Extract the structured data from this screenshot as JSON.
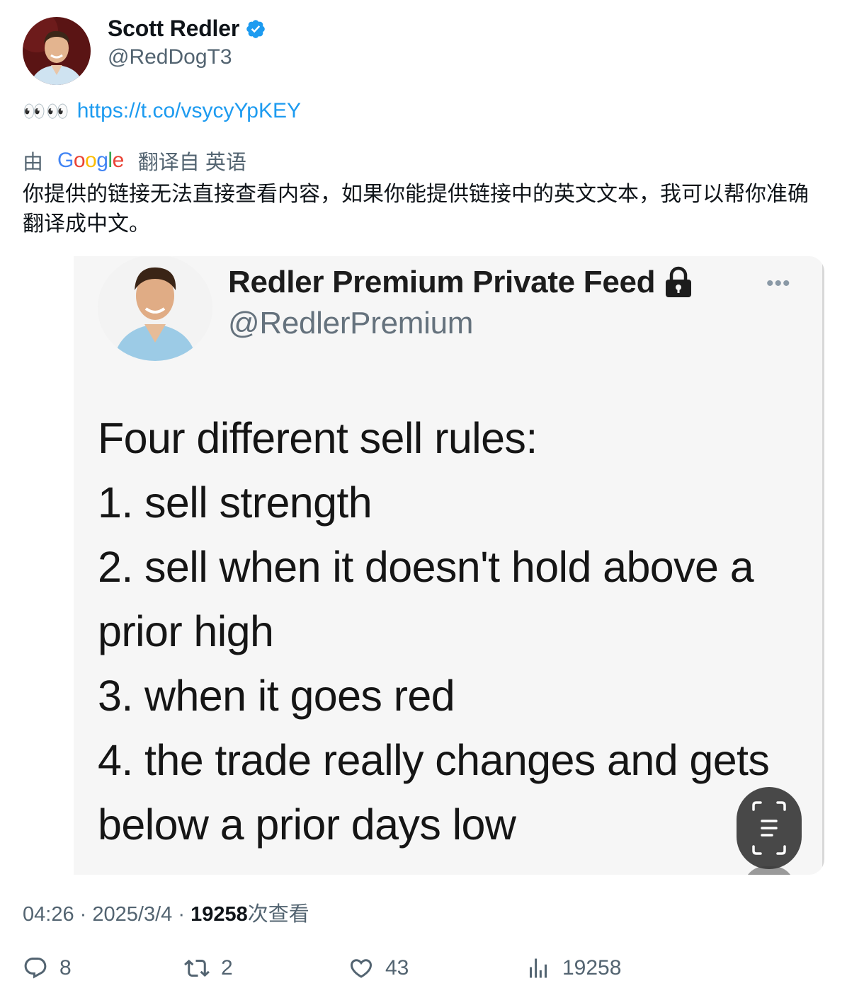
{
  "author": {
    "name": "Scott Redler",
    "handle": "@RedDogT3",
    "verified_icon": "verified-badge-icon",
    "accent": "#1d9bf0"
  },
  "tweet": {
    "emoji": "👀👀",
    "link": "https://t.co/vsycyYpKEY"
  },
  "translation": {
    "prefix": "由",
    "provider": "Google",
    "suffix": "翻译自 英语",
    "text": "你提供的链接无法直接查看内容，如果你能提供链接中的英文文本，我可以帮你准确翻译成中文。"
  },
  "embedded_post": {
    "name": "Redler Premium Private Feed",
    "handle": "@RedlerPremium",
    "more": "•••",
    "lines": [
      "Four different sell rules:",
      "1. sell strength",
      "2. sell when it doesn't hold above a",
      "prior high",
      "3. when it goes red",
      "4. the trade really changes and gets",
      "below a prior days low"
    ]
  },
  "meta": {
    "time": "04:26",
    "sep": "·",
    "date": "2025/3/4",
    "views_count": "19258",
    "views_label": "次查看"
  },
  "actions": {
    "replies": "8",
    "retweets": "2",
    "likes": "43",
    "views": "19258"
  }
}
